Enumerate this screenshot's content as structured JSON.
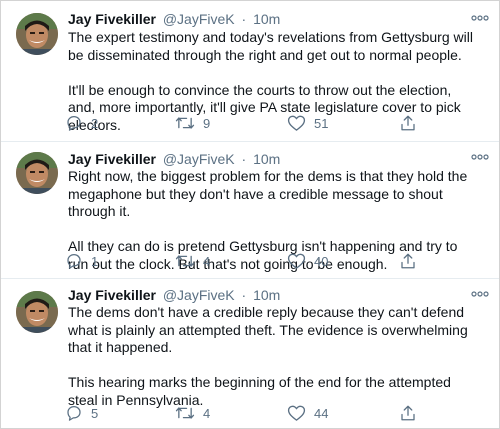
{
  "tweets": [
    {
      "author_name": "Jay Fivekiller",
      "author_handle": "@JayFiveK",
      "separator": "·",
      "time": "10m",
      "paragraphs": [
        "The expert testimony and today's revelations from Gettysburg will be disseminated through the right and get out to normal people.",
        "It'll  be enough to convince the courts to throw out the election, and, more importantly, it'll give PA state legislature cover to pick electors."
      ],
      "replies": "2",
      "retweets": "9",
      "likes": "51"
    },
    {
      "author_name": "Jay Fivekiller",
      "author_handle": "@JayFiveK",
      "separator": "·",
      "time": "10m",
      "paragraphs": [
        "Right now, the biggest problem for the dems is that they hold the megaphone but they don't have a credible message to shout through it.",
        "All they can do is pretend Gettysburg isn't happening and try to run out the clock. But that's not going to be enough."
      ],
      "replies": "1",
      "retweets": "4",
      "likes": "40"
    },
    {
      "author_name": "Jay Fivekiller",
      "author_handle": "@JayFiveK",
      "separator": "·",
      "time": "10m",
      "paragraphs": [
        "The dems don't have a credible reply because they can't defend what is plainly an attempted theft. The evidence is overwhelming that it happened.",
        "This hearing marks the beginning of the end for the attempted steal in Pennsylvania."
      ],
      "replies": "5",
      "retweets": "4",
      "likes": "44"
    }
  ],
  "icons": {
    "avatar": "avatar-photo",
    "more": "more-options-icon",
    "reply": "reply-icon",
    "retweet": "retweet-icon",
    "like": "heart-icon",
    "share": "share-icon"
  },
  "colors": {
    "text": "#0f1419",
    "secondary": "#5b7083",
    "divider": "#e6ecf0"
  }
}
